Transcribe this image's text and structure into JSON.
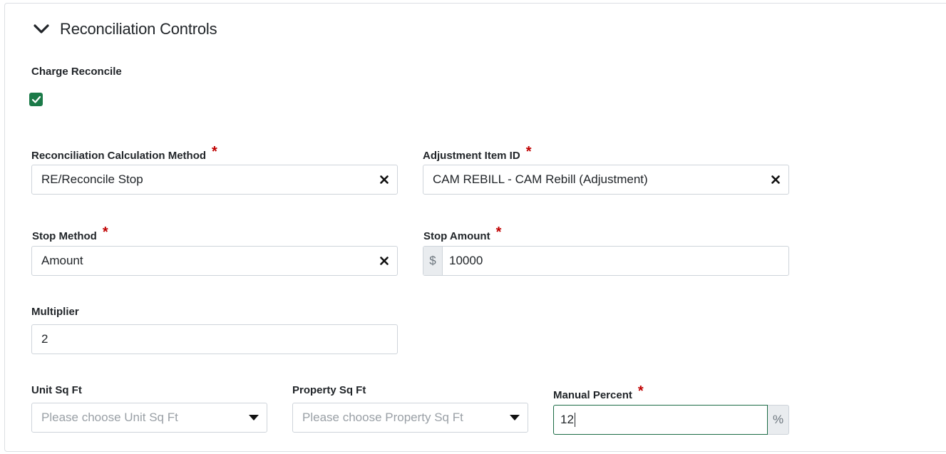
{
  "section": {
    "title": "Reconciliation Controls"
  },
  "charge_reconcile": {
    "label": "Charge Reconcile",
    "checked": true
  },
  "calc_method": {
    "label": "Reconciliation Calculation Method",
    "required": "*",
    "value": "RE/Reconcile Stop"
  },
  "adjustment_item": {
    "label": "Adjustment Item ID",
    "required": "*",
    "value": "CAM REBILL - CAM Rebill (Adjustment)"
  },
  "stop_method": {
    "label": "Stop Method",
    "required": "*",
    "value": "Amount"
  },
  "stop_amount": {
    "label": "Stop Amount",
    "required": "*",
    "prefix": "$",
    "value": "10000"
  },
  "multiplier": {
    "label": "Multiplier",
    "value": "2"
  },
  "unit_sqft": {
    "label": "Unit Sq Ft",
    "placeholder": "Please choose Unit Sq Ft"
  },
  "property_sqft": {
    "label": "Property Sq Ft",
    "placeholder": "Please choose Property Sq Ft"
  },
  "manual_percent": {
    "label": "Manual Percent",
    "required": "*",
    "value": "12",
    "suffix": "%"
  },
  "colors": {
    "accent_green": "#1b7a48",
    "required_red": "#c00000",
    "border": "#ced4da"
  }
}
